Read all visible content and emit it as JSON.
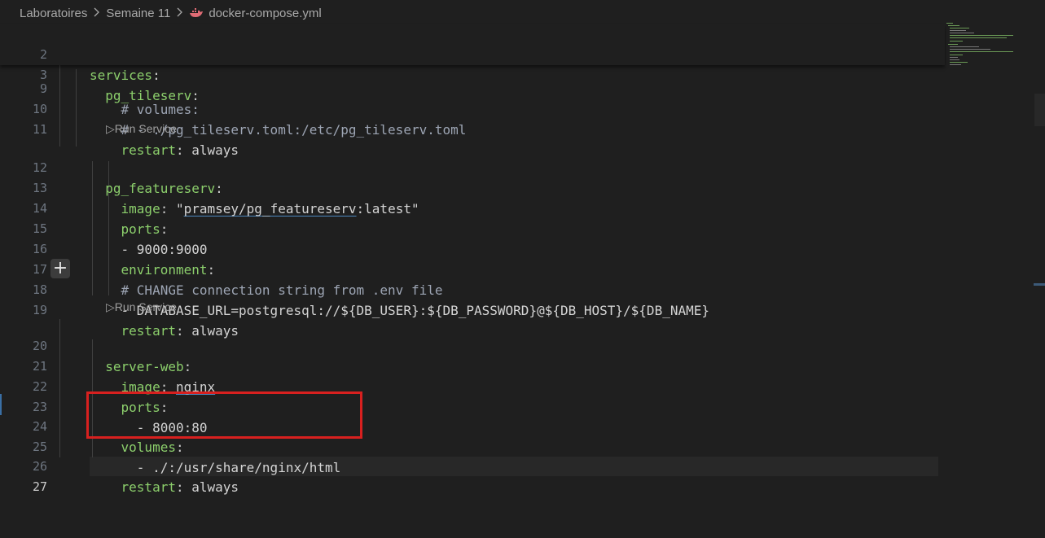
{
  "breadcrumb": {
    "folder1": "Laboratoires",
    "folder2": "Semaine 11",
    "file": "docker-compose.yml"
  },
  "codelens": {
    "run_service_1": "Run Service",
    "run_service_2": "Run Service",
    "run_icon": "▷"
  },
  "lines": [
    {
      "num": "2",
      "indent": "",
      "key": "services",
      "rest": ""
    },
    {
      "num": "3",
      "indent": "  ",
      "key": "pg_tileserv",
      "rest": ""
    },
    {
      "num": "9",
      "indent": "",
      "comment": "    # volumes:"
    },
    {
      "num": "10",
      "indent": "",
      "comment": "    # - ./pg_tileserv.toml:/etc/pg_tileserv.toml"
    },
    {
      "num": "11",
      "indent": "    ",
      "key": "restart",
      "rest": "always"
    },
    {
      "num": "12",
      "indent": "  ",
      "key": "pg_featureserv",
      "rest": ""
    },
    {
      "num": "13",
      "indent": "    ",
      "key": "image",
      "q1": "\"",
      "link": "pramsey/pg_featureserv",
      "q2": ":latest\""
    },
    {
      "num": "14",
      "indent": "    ",
      "key": "ports",
      "rest": ""
    },
    {
      "num": "15",
      "indent": "",
      "plain": "    - 9000:9000"
    },
    {
      "num": "16",
      "indent": "    ",
      "key": "environment",
      "rest": ""
    },
    {
      "num": "17",
      "indent": "",
      "comment": "    # CHANGE connection string from .env file"
    },
    {
      "num": "18",
      "indent": "",
      "plain": "    - DATABASE_URL=postgresql://${DB_USER}:${DB_PASSWORD}@${DB_HOST}/${DB_NAME}"
    },
    {
      "num": "19",
      "indent": "    ",
      "key": "restart",
      "rest": "always"
    },
    {
      "num": "20",
      "indent": "  ",
      "key": "server-web",
      "rest": ""
    },
    {
      "num": "21",
      "indent": "    ",
      "key": "image",
      "link": "nginx"
    },
    {
      "num": "22",
      "indent": "    ",
      "key": "ports",
      "rest": ""
    },
    {
      "num": "23",
      "indent": "",
      "plain": "      - 8000:80"
    },
    {
      "num": "24",
      "indent": "    ",
      "key": "volumes",
      "rest": ""
    },
    {
      "num": "25",
      "indent": "",
      "plain": "      - ./:/usr/share/nginx/html"
    },
    {
      "num": "26",
      "indent": "    ",
      "key": "restart",
      "rest": "always"
    },
    {
      "num": "27",
      "indent": "",
      "plain": ""
    }
  ],
  "colors": {
    "background": "#1f1f1f",
    "yaml_key": "#8ccf6c",
    "highlight_box": "#d8201f"
  }
}
